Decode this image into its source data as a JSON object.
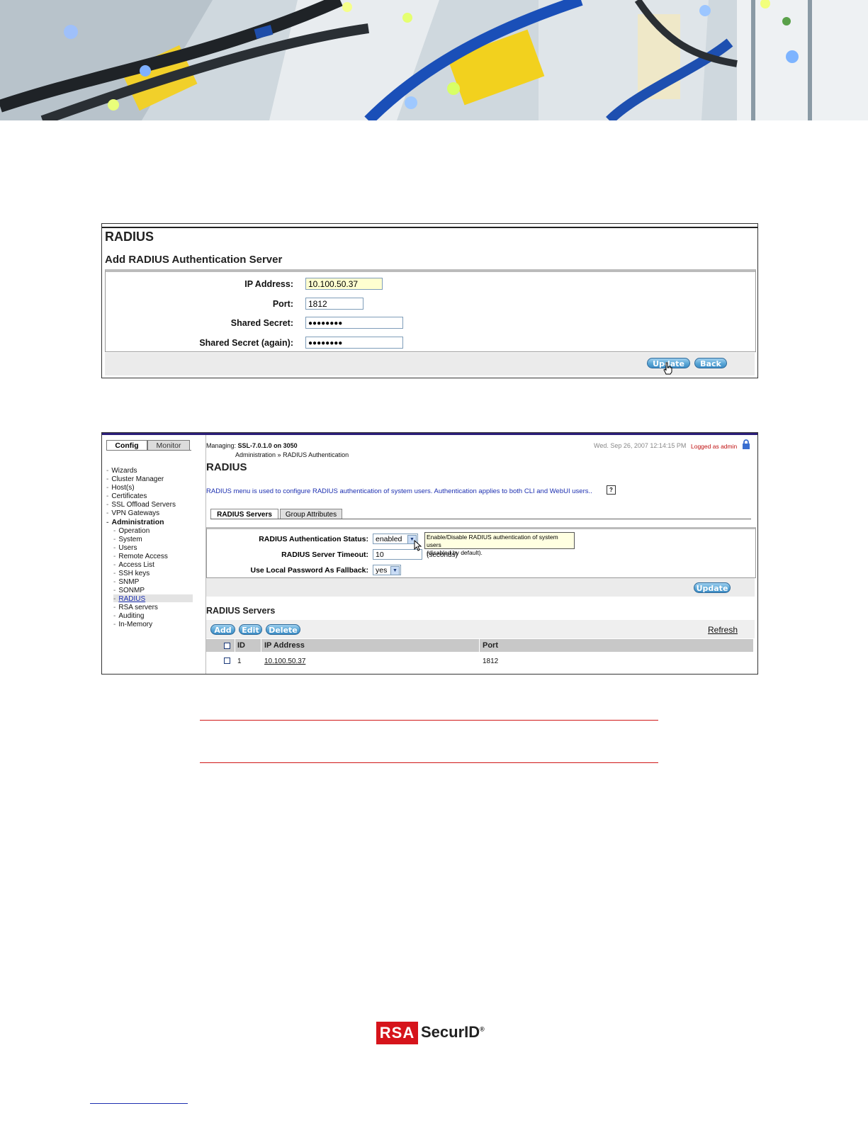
{
  "shot1": {
    "heading": "RADIUS",
    "subheading": "Add RADIUS Authentication Server",
    "fields": [
      {
        "label": "IP Address:",
        "value": "10.100.50.37"
      },
      {
        "label": "Port:",
        "value": "1812"
      },
      {
        "label": "Shared Secret:",
        "value": "●●●●●●●●"
      },
      {
        "label": "Shared Secret (again):",
        "value": "●●●●●●●●"
      }
    ],
    "update_label": "Update",
    "back_label": "Back"
  },
  "shot2": {
    "tabs": {
      "config": "Config",
      "monitor": "Monitor"
    },
    "nav": [
      {
        "label": "Wizards"
      },
      {
        "label": "Cluster Manager"
      },
      {
        "label": "Host(s)"
      },
      {
        "label": "Certificates"
      },
      {
        "label": "SSL Offload Servers"
      },
      {
        "label": "VPN Gateways"
      },
      {
        "label": "Administration"
      },
      {
        "label": "Operation"
      },
      {
        "label": "System"
      },
      {
        "label": "Users"
      },
      {
        "label": "Remote Access"
      },
      {
        "label": "Access List"
      },
      {
        "label": "SSH keys"
      },
      {
        "label": "SNMP"
      },
      {
        "label": "SONMP"
      },
      {
        "label": "RADIUS"
      },
      {
        "label": "RSA servers"
      },
      {
        "label": "Auditing"
      },
      {
        "label": "In-Memory"
      }
    ],
    "managing_label": "Managing:",
    "managing_value": "SSL-7.0.1.0 on 3050",
    "breadcrumb_root": "Administration",
    "breadcrumb_sep": "»",
    "breadcrumb_leaf": "RADIUS Authentication",
    "datetime": "Wed. Sep 26, 2007 12:14:15 PM",
    "logged_as": "Logged as admin",
    "title": "RADIUS",
    "description": "RADIUS menu is used to configure RADIUS authentication of system users. Authentication applies to both CLI and WebUI users..",
    "help_glyph": "?",
    "subtabs": {
      "active": "RADIUS Servers",
      "inactive": "Group Attributes"
    },
    "form": {
      "status_label": "RADIUS Authentication Status:",
      "status_value": "enabled",
      "timeout_label": "RADIUS Server Timeout:",
      "timeout_value": "10",
      "timeout_unit": "(seconds)",
      "fallback_label": "Use Local Password As Fallback:",
      "fallback_value": "yes"
    },
    "tooltip_line1": "Enable/Disable RADIUS authentication of system users",
    "tooltip_line2": "(disabled by default).",
    "update_label": "Update",
    "servers_heading": "RADIUS Servers",
    "add_label": "Add",
    "edit_label": "Edit",
    "delete_label": "Delete",
    "refresh_label": "Refresh",
    "columns": {
      "id": "ID",
      "ip": "IP Address",
      "port": "Port"
    },
    "rows": [
      {
        "id": "1",
        "ip": "10.100.50.37",
        "port": "1812"
      }
    ]
  },
  "logo": {
    "mark": "RSA",
    "word": "SecurID",
    "reg": "®"
  },
  "colors": {
    "accent_red": "#d6141b",
    "link_blue": "#1c2fb0",
    "button_blue": "#5aa6d6"
  }
}
